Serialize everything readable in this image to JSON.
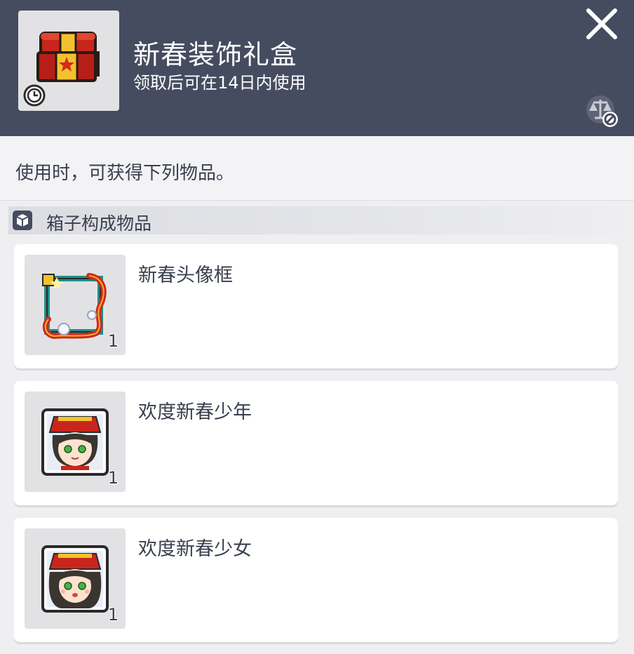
{
  "header": {
    "title": "新春装饰礼盒",
    "subtitle": "领取后可在14日内使用",
    "close_icon": "close-icon",
    "trade_icon": "scale-blocked-icon",
    "item_icon": "treasure-chest-icon",
    "clock_icon": "clock-icon"
  },
  "description": "使用时，可获得下列物品。",
  "section": {
    "icon": "box-icon",
    "label": "箱子构成物品"
  },
  "items": [
    {
      "name": "新春头像框",
      "qty": "1",
      "icon": "avatar-frame-icon"
    },
    {
      "name": "欢度新春少年",
      "qty": "1",
      "icon": "boy-avatar-icon"
    },
    {
      "name": "欢度新春少女",
      "qty": "1",
      "icon": "girl-avatar-icon"
    }
  ],
  "colors": {
    "header_bg": "#454c60",
    "page_bg": "#efeff1",
    "card_bg": "#ffffff",
    "text": "#3a3f4e"
  }
}
